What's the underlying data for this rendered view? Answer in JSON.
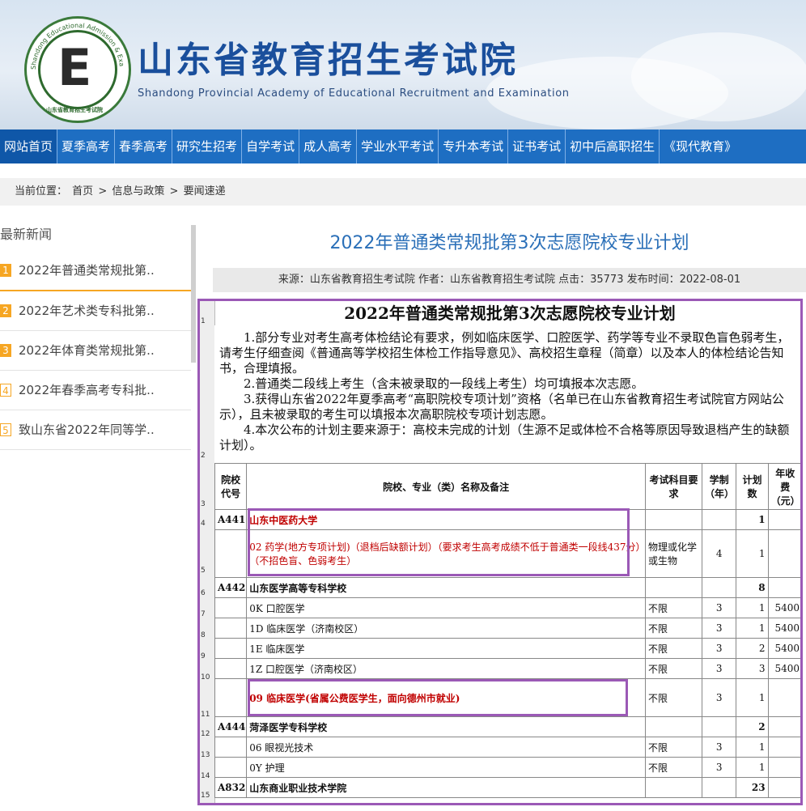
{
  "header": {
    "logo_ring_text": "Shandong Educational Admission & Examinations",
    "logo_bottom_text": "山东省教育招生考试院",
    "title": "山东省教育招生考试院",
    "subtitle": "Shandong Provincial Academy of Educational Recruitment and Examination"
  },
  "nav": [
    "网站首页",
    "夏季高考",
    "春季高考",
    "研究生招考",
    "自学考试",
    "成人高考",
    "学业水平考试",
    "专升本考试",
    "证书考试",
    "初中后高职招生",
    "《现代教育》"
  ],
  "breadcrumb": [
    "当前位置：",
    "首页",
    ">",
    "信息与政策",
    ">",
    "要闻速递"
  ],
  "sidebar": {
    "title": "最新新闻",
    "items": [
      {
        "num": "1",
        "label": "2022年普通类常规批第.."
      },
      {
        "num": "2",
        "label": "2022年艺术类专科批第.."
      },
      {
        "num": "3",
        "label": "2022年体育类常规批第.."
      },
      {
        "num": "4",
        "label": "2022年春季高考专科批.."
      },
      {
        "num": "5",
        "label": "致山东省2022年同等学.."
      }
    ]
  },
  "article": {
    "title": "2022年普通类常规批第3次志愿院校专业计划",
    "meta": "来源：山东省教育招生考试院 作者：山东省教育招生考试院 点击：35773 发布时间：2022-08-01"
  },
  "sheet": {
    "title": "2022年普通类常规批第3次志愿院校专业计划",
    "notes": [
      "1.部分专业对考生高考体检结论有要求，例如临床医学、口腔医学、药学等专业不录取色盲色弱考生，请考生仔细查阅《普通高等学校招生体检工作指导意见》、高校招生章程（简章）以及本人的体检结论告知书，合理填报。",
      "2.普通类二段线上考生（含未被录取的一段线上考生）均可填报本次志愿。",
      "3.获得山东省2022年夏季高考“高职院校专项计划”资格（名单已在山东省教育招生考试院官方网站公示），且未被录取的考生可以填报本次高职院校专项计划志愿。",
      "4.本次公布的计划主要来源于：高校未完成的计划（生源不足或体检不合格等原因导致退档产生的缺额计划）。"
    ],
    "headers": [
      "院校代号",
      "院校、专业（类）名称及备注",
      "考试科目要求",
      "学制（年）",
      "计划数",
      "年收费（元）"
    ],
    "rows": [
      {
        "code": "A441",
        "name": "山东中医药大学",
        "subj": "",
        "years": "",
        "plan": "1",
        "fee": "",
        "type": "school-red"
      },
      {
        "code": "",
        "name": "02 药学(地方专项计划)（退档后缺额计划）（要求考生高考成绩不低于普通类一段线437分）（不招色盲、色弱考生）",
        "subj": "物理或化学或生物",
        "years": "4",
        "plan": "1",
        "fee": "",
        "type": "major-red"
      },
      {
        "code": "A442",
        "name": "山东医学高等专科学校",
        "subj": "",
        "years": "",
        "plan": "8",
        "fee": "",
        "type": "school"
      },
      {
        "code": "",
        "name": "0K 口腔医学",
        "subj": "不限",
        "years": "3",
        "plan": "1",
        "fee": "5400",
        "type": "major"
      },
      {
        "code": "",
        "name": "1D 临床医学（济南校区）",
        "subj": "不限",
        "years": "3",
        "plan": "1",
        "fee": "5400",
        "type": "major"
      },
      {
        "code": "",
        "name": "1E 临床医学",
        "subj": "不限",
        "years": "3",
        "plan": "2",
        "fee": "5400",
        "type": "major"
      },
      {
        "code": "",
        "name": "1Z 口腔医学（济南校区）",
        "subj": "不限",
        "years": "3",
        "plan": "3",
        "fee": "5400",
        "type": "major"
      },
      {
        "code": "",
        "name": "09 临床医学(省属公费医学生，面向德州市就业)",
        "subj": "不限",
        "years": "3",
        "plan": "1",
        "fee": "",
        "type": "major-red2"
      },
      {
        "code": "A444",
        "name": "菏泽医学专科学校",
        "subj": "",
        "years": "",
        "plan": "2",
        "fee": "",
        "type": "school"
      },
      {
        "code": "",
        "name": "06 眼视光技术",
        "subj": "不限",
        "years": "3",
        "plan": "1",
        "fee": "",
        "type": "major"
      },
      {
        "code": "",
        "name": "0Y 护理",
        "subj": "不限",
        "years": "3",
        "plan": "1",
        "fee": "",
        "type": "major"
      },
      {
        "code": "A832",
        "name": "山东商业职业技术学院",
        "subj": "",
        "years": "",
        "plan": "23",
        "fee": "",
        "type": "school"
      }
    ],
    "row_numbers": [
      "1",
      "2",
      "3",
      "4",
      "5",
      "6",
      "7",
      "8",
      "9",
      "10",
      "11",
      "12",
      "13",
      "14",
      "15"
    ]
  }
}
